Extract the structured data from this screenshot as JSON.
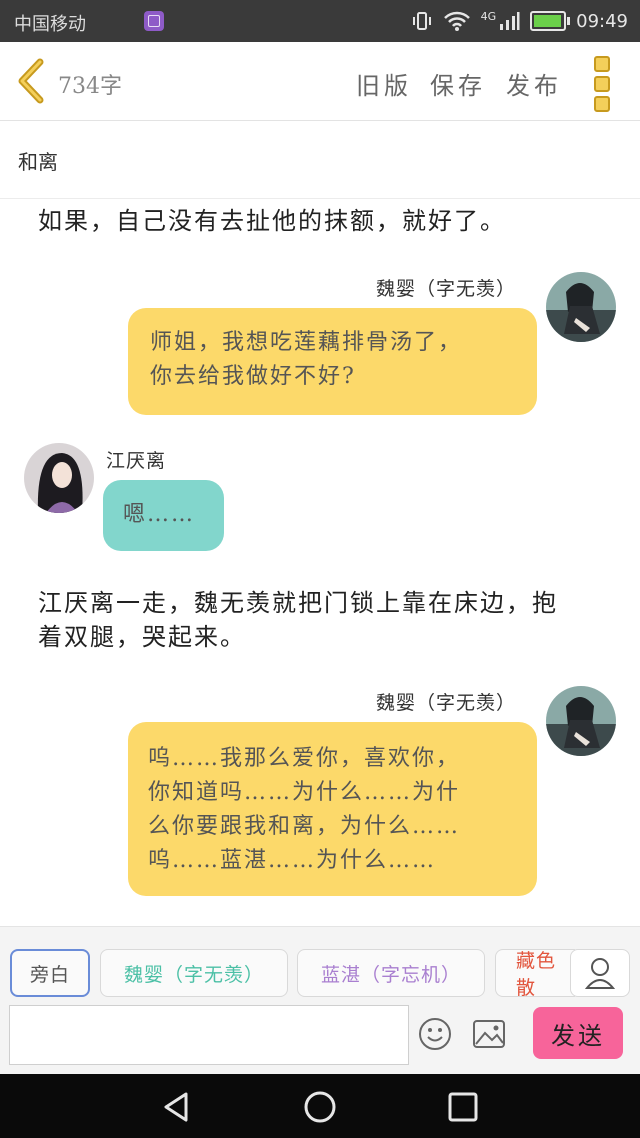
{
  "status_bar": {
    "carrier": "中国移动",
    "network": "4G",
    "time": "09:49",
    "battery_level": 0.85
  },
  "header": {
    "word_count": "734字",
    "old_version": "旧版",
    "save": "保存",
    "publish": "发布"
  },
  "document": {
    "title": "和离"
  },
  "story": {
    "narration_1": "如果，自己没有去扯他的抹额，就好了。",
    "msg_1": {
      "speaker": "魏婴（字无羡）",
      "line1": "师姐，我想吃莲藕排骨汤了，",
      "line2": "你去给我做好不好?"
    },
    "msg_2": {
      "speaker": "江厌离",
      "text": "嗯……"
    },
    "narration_2_line1": "江厌离一走，魏无羡就把门锁上靠在床边，抱",
    "narration_2_line2": "着双腿，哭起来。",
    "msg_3": {
      "speaker": "魏婴（字无羡）",
      "line1": "呜……我那么爱你，喜欢你，",
      "line2": "你知道吗……为什么……为什",
      "line3": "么你要跟我和离，为什么……",
      "line4": "呜……蓝湛……为什么……"
    }
  },
  "composer": {
    "chips": [
      "旁白",
      "魏婴（字无羡）",
      "蓝湛（字忘机）",
      "藏色散"
    ],
    "input_value": "",
    "send_label": "发送"
  },
  "colors": {
    "yellow_bubble": "#fcd96a",
    "teal_bubble": "#82d6cc",
    "send_button": "#f7649a"
  }
}
